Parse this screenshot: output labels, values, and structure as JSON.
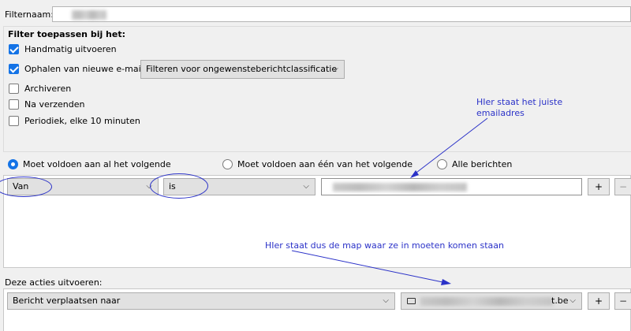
{
  "filter_name": {
    "label": "Filternaam:"
  },
  "apply": {
    "heading": "Filter toepassen bij het:",
    "options": [
      {
        "label": "Handmatig uitvoeren",
        "checked": true
      },
      {
        "label": "Ophalen van nieuwe e-mail:",
        "checked": true
      },
      {
        "label": "Archiveren",
        "checked": false
      },
      {
        "label": "Na verzenden",
        "checked": false
      },
      {
        "label": "Periodiek, elke 10 minuten",
        "checked": false
      }
    ],
    "fetch_select": "Filteren voor ongewensteberichtclassificatie"
  },
  "match": {
    "options": [
      {
        "label": "Moet voldoen aan al het volgende",
        "selected": true
      },
      {
        "label": "Moet voldoen aan één van het volgende",
        "selected": false
      },
      {
        "label": "Alle berichten",
        "selected": false
      }
    ]
  },
  "rule": {
    "field": "Van",
    "operator": "is",
    "add": "+",
    "remove": "−"
  },
  "actions": {
    "heading": "Deze acties uitvoeren:",
    "action": "Bericht verplaatsen naar",
    "folder_suffix": "t.be",
    "add": "+",
    "remove": "−"
  },
  "annotations": {
    "email_note_line1": "HIer staat het juiste",
    "email_note_line2": "emailadres",
    "folder_note": "HIer staat dus de map waar ze in moeten komen staan",
    "color": "#2b32c8"
  }
}
